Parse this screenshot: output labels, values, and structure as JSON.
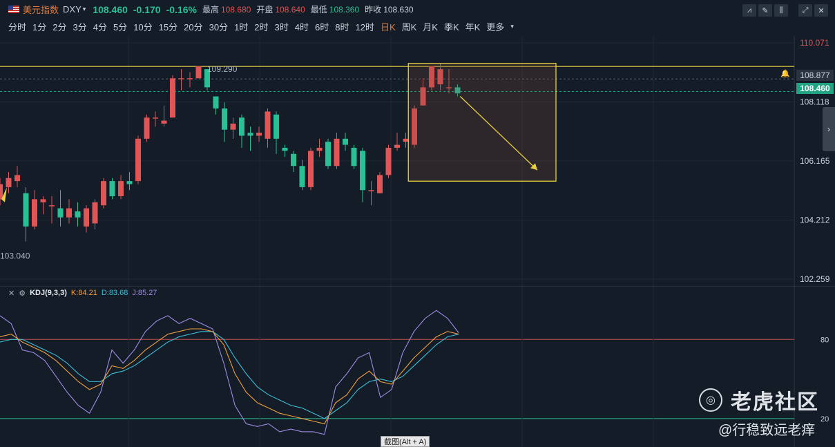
{
  "header": {
    "title": "美元指数",
    "symbol": "DXY",
    "price": "108.460",
    "change": "-0.170",
    "change_pct": "-0.16%",
    "high_label": "最高",
    "high": "108.680",
    "open_label": "开盘",
    "open": "108.640",
    "low_label": "最低",
    "low": "108.360",
    "prev_close_label": "昨收",
    "prev_close": "108.630"
  },
  "toolbar": {
    "icons": [
      "indicator-icon",
      "draw-icon",
      "candle-style-icon",
      "fullscreen-icon",
      "close-icon"
    ],
    "glyphs": [
      "⩘",
      "✎",
      "⫼",
      "⤢",
      "✕"
    ]
  },
  "periods": [
    {
      "label": "分时",
      "active": false
    },
    {
      "label": "1分",
      "active": false
    },
    {
      "label": "2分",
      "active": false
    },
    {
      "label": "3分",
      "active": false
    },
    {
      "label": "4分",
      "active": false
    },
    {
      "label": "5分",
      "active": false
    },
    {
      "label": "10分",
      "active": false
    },
    {
      "label": "15分",
      "active": false
    },
    {
      "label": "20分",
      "active": false
    },
    {
      "label": "30分",
      "active": false
    },
    {
      "label": "1时",
      "active": false
    },
    {
      "label": "2时",
      "active": false
    },
    {
      "label": "3时",
      "active": false
    },
    {
      "label": "4时",
      "active": false
    },
    {
      "label": "6时",
      "active": false
    },
    {
      "label": "8时",
      "active": false
    },
    {
      "label": "12时",
      "active": false
    },
    {
      "label": "日K",
      "active": true
    },
    {
      "label": "周K",
      "active": false
    },
    {
      "label": "月K",
      "active": false
    },
    {
      "label": "季K",
      "active": false
    },
    {
      "label": "年K",
      "active": false
    },
    {
      "label": "更多",
      "active": false
    }
  ],
  "axis": {
    "ticks": [
      "110.071",
      "108.118",
      "106.165",
      "104.212",
      "102.259"
    ],
    "alert_price": "108.877",
    "current_price": "108.460"
  },
  "annotations": {
    "high_label": "109.290",
    "low_label": "103.040"
  },
  "kdj": {
    "name": "KDJ(9,3,3)",
    "k_label": "K:84.21",
    "d_label": "D:83.68",
    "j_label": "J:85.27",
    "levels": [
      "80",
      "20"
    ]
  },
  "overlay": {
    "screenshot_tip": "截图(Alt + A)",
    "watermark": "老虎社区",
    "watermark_user": "@行稳致远老痒"
  },
  "colors": {
    "up": "#e05555",
    "down": "#2bbf96",
    "box": "#e8d040",
    "k": "#f0a040",
    "d": "#3bbfd8",
    "j": "#a08ce6"
  },
  "chart_data": {
    "type": "candlestick",
    "y_range": [
      102.259,
      110.071
    ],
    "candles": [
      {
        "o": 104.9,
        "c": 105.4,
        "h": 105.6,
        "l": 104.7
      },
      {
        "o": 105.3,
        "c": 105.6,
        "h": 105.8,
        "l": 105.1
      },
      {
        "o": 105.5,
        "c": 105.7,
        "h": 106.0,
        "l": 105.3
      },
      {
        "o": 105.1,
        "c": 104.0,
        "h": 105.3,
        "l": 103.5
      },
      {
        "o": 104.0,
        "c": 104.9,
        "h": 105.2,
        "l": 103.9
      },
      {
        "o": 104.8,
        "c": 104.9,
        "h": 105.0,
        "l": 104.4
      },
      {
        "o": 104.7,
        "c": 104.7,
        "h": 105.0,
        "l": 104.1
      },
      {
        "o": 104.6,
        "c": 104.3,
        "h": 105.2,
        "l": 104.0
      },
      {
        "o": 104.3,
        "c": 104.6,
        "h": 104.9,
        "l": 104.1
      },
      {
        "o": 104.5,
        "c": 104.3,
        "h": 104.8,
        "l": 104.0
      },
      {
        "o": 104.0,
        "c": 104.6,
        "h": 104.7,
        "l": 103.8
      },
      {
        "o": 104.1,
        "c": 104.8,
        "h": 104.9,
        "l": 103.9
      },
      {
        "o": 104.7,
        "c": 105.5,
        "h": 105.6,
        "l": 104.6
      },
      {
        "o": 105.5,
        "c": 105.0,
        "h": 105.6,
        "l": 104.9
      },
      {
        "o": 105.0,
        "c": 105.5,
        "h": 105.7,
        "l": 104.9
      },
      {
        "o": 105.5,
        "c": 105.4,
        "h": 105.8,
        "l": 105.2
      },
      {
        "o": 105.5,
        "c": 106.9,
        "h": 107.0,
        "l": 105.4
      },
      {
        "o": 106.9,
        "c": 107.6,
        "h": 107.7,
        "l": 106.8
      },
      {
        "o": 107.6,
        "c": 107.6,
        "h": 107.8,
        "l": 107.3
      },
      {
        "o": 107.4,
        "c": 107.5,
        "h": 108.0,
        "l": 107.3
      },
      {
        "o": 107.6,
        "c": 108.9,
        "h": 109.0,
        "l": 107.6
      },
      {
        "o": 108.9,
        "c": 108.9,
        "h": 109.2,
        "l": 108.5
      },
      {
        "o": 108.9,
        "c": 108.9,
        "h": 109.1,
        "l": 108.6
      },
      {
        "o": 108.9,
        "c": 109.3,
        "h": 109.3,
        "l": 108.9
      },
      {
        "o": 109.2,
        "c": 108.6,
        "h": 109.2,
        "l": 108.5
      },
      {
        "o": 108.3,
        "c": 107.9,
        "h": 108.3,
        "l": 107.7
      },
      {
        "o": 107.9,
        "c": 107.2,
        "h": 108.1,
        "l": 106.8
      },
      {
        "o": 107.2,
        "c": 107.4,
        "h": 107.6,
        "l": 106.9
      },
      {
        "o": 107.6,
        "c": 107.0,
        "h": 107.7,
        "l": 106.6
      },
      {
        "o": 107.1,
        "c": 107.0,
        "h": 107.3,
        "l": 106.5
      },
      {
        "o": 107.0,
        "c": 107.1,
        "h": 107.3,
        "l": 106.8
      },
      {
        "o": 106.9,
        "c": 107.8,
        "h": 107.9,
        "l": 106.6
      },
      {
        "o": 107.7,
        "c": 106.9,
        "h": 107.8,
        "l": 106.4
      },
      {
        "o": 106.6,
        "c": 106.5,
        "h": 106.7,
        "l": 106.3
      },
      {
        "o": 106.4,
        "c": 106.0,
        "h": 106.5,
        "l": 105.8
      },
      {
        "o": 106.0,
        "c": 105.3,
        "h": 106.2,
        "l": 105.2
      },
      {
        "o": 105.3,
        "c": 106.5,
        "h": 106.6,
        "l": 105.2
      },
      {
        "o": 106.5,
        "c": 106.6,
        "h": 106.9,
        "l": 106.3
      },
      {
        "o": 106.8,
        "c": 106.0,
        "h": 106.9,
        "l": 105.9
      },
      {
        "o": 106.0,
        "c": 106.9,
        "h": 107.1,
        "l": 105.9
      },
      {
        "o": 106.9,
        "c": 106.7,
        "h": 107.1,
        "l": 106.5
      },
      {
        "o": 106.6,
        "c": 106.0,
        "h": 106.7,
        "l": 105.9
      },
      {
        "o": 106.5,
        "c": 105.2,
        "h": 106.6,
        "l": 104.8
      },
      {
        "o": 105.2,
        "c": 105.2,
        "h": 105.5,
        "l": 104.7
      },
      {
        "o": 105.1,
        "c": 105.7,
        "h": 105.8,
        "l": 105.1
      },
      {
        "o": 105.7,
        "c": 106.6,
        "h": 106.7,
        "l": 105.6
      },
      {
        "o": 106.6,
        "c": 106.7,
        "h": 107.1,
        "l": 106.5
      },
      {
        "o": 106.8,
        "c": 106.9,
        "h": 107.1,
        "l": 106.6
      },
      {
        "o": 106.7,
        "c": 107.9,
        "h": 108.0,
        "l": 106.6
      },
      {
        "o": 108.0,
        "c": 108.6,
        "h": 108.9,
        "l": 108.0
      },
      {
        "o": 108.6,
        "c": 109.3,
        "h": 109.3,
        "l": 108.5
      },
      {
        "o": 108.7,
        "c": 109.2,
        "h": 109.4,
        "l": 108.5
      },
      {
        "o": 108.6,
        "c": 108.6,
        "h": 109.2,
        "l": 108.4
      },
      {
        "o": 108.6,
        "c": 108.4,
        "h": 108.7,
        "l": 108.3
      }
    ],
    "kdj": {
      "y_range": [
        0,
        110
      ],
      "K": [
        82,
        84,
        78,
        74,
        70,
        64,
        56,
        48,
        42,
        46,
        60,
        58,
        64,
        72,
        78,
        84,
        86,
        88,
        88,
        86,
        76,
        54,
        40,
        32,
        28,
        24,
        22,
        20,
        18,
        16,
        32,
        38,
        50,
        56,
        48,
        46,
        56,
        66,
        74,
        82,
        86,
        84
      ],
      "D": [
        78,
        80,
        80,
        76,
        72,
        68,
        62,
        54,
        48,
        48,
        54,
        56,
        60,
        66,
        72,
        78,
        82,
        84,
        86,
        86,
        80,
        66,
        54,
        44,
        38,
        34,
        30,
        28,
        24,
        20,
        26,
        32,
        42,
        48,
        50,
        48,
        52,
        60,
        68,
        76,
        82,
        84
      ],
      "J": [
        98,
        92,
        72,
        70,
        64,
        52,
        40,
        30,
        24,
        40,
        72,
        62,
        72,
        86,
        94,
        98,
        92,
        96,
        92,
        88,
        62,
        30,
        16,
        14,
        16,
        10,
        12,
        10,
        10,
        8,
        44,
        54,
        66,
        70,
        36,
        42,
        70,
        86,
        96,
        102,
        96,
        85
      ]
    }
  }
}
